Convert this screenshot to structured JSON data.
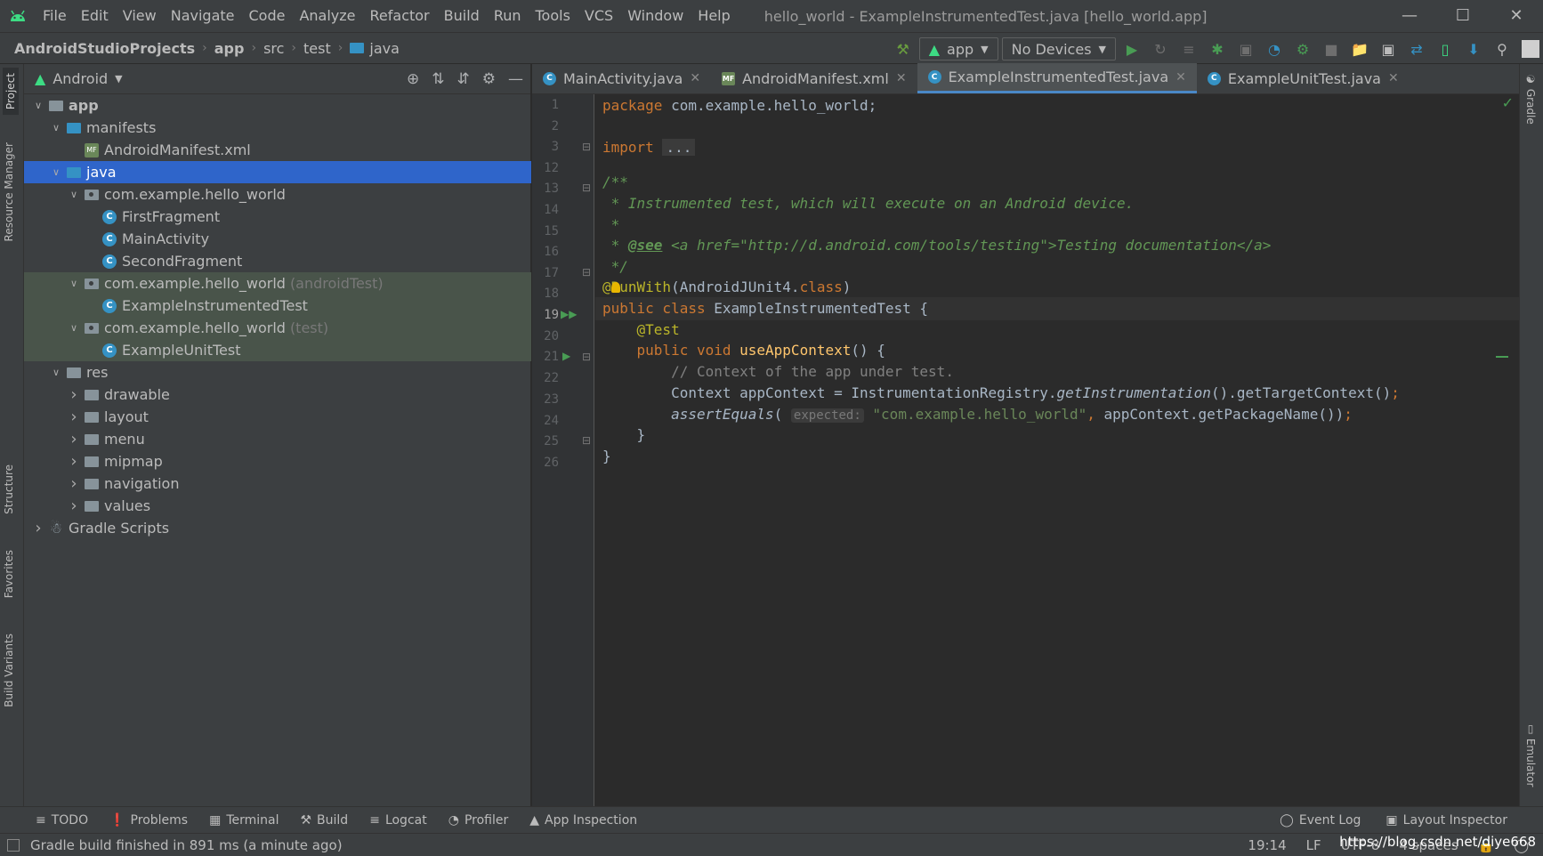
{
  "menubar": {
    "items": [
      "File",
      "Edit",
      "View",
      "Navigate",
      "Code",
      "Analyze",
      "Refactor",
      "Build",
      "Run",
      "Tools",
      "VCS",
      "Window",
      "Help"
    ],
    "window_title": "hello_world - ExampleInstrumentedTest.java [hello_world.app]"
  },
  "breadcrumb": [
    "AndroidStudioProjects",
    "app",
    "src",
    "test",
    "java"
  ],
  "toolbar": {
    "run_config": "app",
    "device": "No Devices"
  },
  "project_panel": {
    "view_mode": "Android",
    "tree": [
      {
        "label": "app",
        "extra": "",
        "depth": 0,
        "arrow": "down",
        "icon": "folder",
        "bold": true
      },
      {
        "label": "manifests",
        "extra": "",
        "depth": 1,
        "arrow": "down",
        "icon": "folder-blue"
      },
      {
        "label": "AndroidManifest.xml",
        "extra": "",
        "depth": 2,
        "arrow": "",
        "icon": "manifest"
      },
      {
        "label": "java",
        "extra": "",
        "depth": 1,
        "arrow": "down",
        "icon": "folder-blue",
        "selected": true
      },
      {
        "label": "com.example.hello_world",
        "extra": "",
        "depth": 2,
        "arrow": "down",
        "icon": "package"
      },
      {
        "label": "FirstFragment",
        "extra": "",
        "depth": 3,
        "arrow": "",
        "icon": "class"
      },
      {
        "label": "MainActivity",
        "extra": "",
        "depth": 3,
        "arrow": "",
        "icon": "class"
      },
      {
        "label": "SecondFragment",
        "extra": "",
        "depth": 3,
        "arrow": "",
        "icon": "class"
      },
      {
        "label": "com.example.hello_world",
        "extra": "(androidTest)",
        "depth": 2,
        "arrow": "down",
        "icon": "package",
        "test": true
      },
      {
        "label": "ExampleInstrumentedTest",
        "extra": "",
        "depth": 3,
        "arrow": "",
        "icon": "class",
        "test": true
      },
      {
        "label": "com.example.hello_world",
        "extra": "(test)",
        "depth": 2,
        "arrow": "down",
        "icon": "package",
        "test": true
      },
      {
        "label": "ExampleUnitTest",
        "extra": "",
        "depth": 3,
        "arrow": "",
        "icon": "class",
        "test": true
      },
      {
        "label": "res",
        "extra": "",
        "depth": 1,
        "arrow": "down",
        "icon": "folder"
      },
      {
        "label": "drawable",
        "extra": "",
        "depth": 2,
        "arrow": "right",
        "icon": "folder"
      },
      {
        "label": "layout",
        "extra": "",
        "depth": 2,
        "arrow": "right",
        "icon": "folder"
      },
      {
        "label": "menu",
        "extra": "",
        "depth": 2,
        "arrow": "right",
        "icon": "folder"
      },
      {
        "label": "mipmap",
        "extra": "",
        "depth": 2,
        "arrow": "right",
        "icon": "folder"
      },
      {
        "label": "navigation",
        "extra": "",
        "depth": 2,
        "arrow": "right",
        "icon": "folder"
      },
      {
        "label": "values",
        "extra": "",
        "depth": 2,
        "arrow": "right",
        "icon": "folder"
      },
      {
        "label": "Gradle Scripts",
        "extra": "",
        "depth": 0,
        "arrow": "right",
        "icon": "gradle"
      }
    ]
  },
  "left_strip": {
    "project": "Project",
    "resource_manager": "Resource Manager",
    "structure": "Structure",
    "favorites": "Favorites",
    "build_variants": "Build Variants"
  },
  "right_strip": {
    "gradle": "Gradle",
    "emulator": "Emulator"
  },
  "editor": {
    "tabs": [
      {
        "label": "MainActivity.java",
        "icon": "C",
        "active": false
      },
      {
        "label": "AndroidManifest.xml",
        "icon": "MF",
        "active": false
      },
      {
        "label": "ExampleInstrumentedTest.java",
        "icon": "C",
        "active": true
      },
      {
        "label": "ExampleUnitTest.java",
        "icon": "C",
        "active": false
      }
    ],
    "line_numbers": [
      "1",
      "2",
      "3",
      "12",
      "13",
      "14",
      "15",
      "16",
      "17",
      "18",
      "19",
      "20",
      "21",
      "22",
      "23",
      "24",
      "25",
      "26"
    ],
    "current_line": "19",
    "code": {
      "l1_kw": "package",
      "l1_rest": " com.example.hello_world;",
      "l3_kw": "import",
      "l3_fold": "...",
      "l13": "/**",
      "l14": " * Instrumented test, which will execute on an Android device.",
      "l15": " *",
      "l16_a": " * ",
      "l16_tag": "@see",
      "l16_b": " <a href=\"http://d.android.com/tools/testing\">",
      "l16_c": "Testing documentation",
      "l16_d": "</a>",
      "l17": " */",
      "l18_ann": "@RunWith",
      "l18_rest_a": "(AndroidJUnit4.",
      "l18_kw": "class",
      "l18_rest_b": ")",
      "l19_kw": "public class",
      "l19_name": " ExampleInstrumentedTest",
      "l19_rest": " {",
      "l20_ann": "    @Test",
      "l21_kw": "    public void",
      "l21_fn": " useAppContext",
      "l21_rest": "() {",
      "l22": "        // Context of the app under test.",
      "l23_a": "        Context appContext = InstrumentationRegistry.",
      "l23_it": "getInstrumentation",
      "l23_b": "().getTargetContext()",
      "l23_semi": ";",
      "l24_it": "        assertEquals",
      "l24_a": "( ",
      "l24_hint": "expected:",
      "l24_str": " \"com.example.hello_world\"",
      "l24_comma": ",",
      "l24_b": " appContext.getPackageName())",
      "l24_semi": ";",
      "l25": "    }",
      "l26": "}"
    }
  },
  "bottom_tools": {
    "left": [
      "TODO",
      "Problems",
      "Terminal",
      "Build",
      "Logcat",
      "Profiler",
      "App Inspection"
    ],
    "right": [
      "Event Log",
      "Layout Inspector"
    ]
  },
  "statusbar": {
    "message": "Gradle build finished in 891 ms (a minute ago)",
    "position": "19:14",
    "line_sep": "LF",
    "encoding": "UTF-8",
    "indent": "4 spaces",
    "watermark": "https://blog.csdn.net/diye668"
  }
}
